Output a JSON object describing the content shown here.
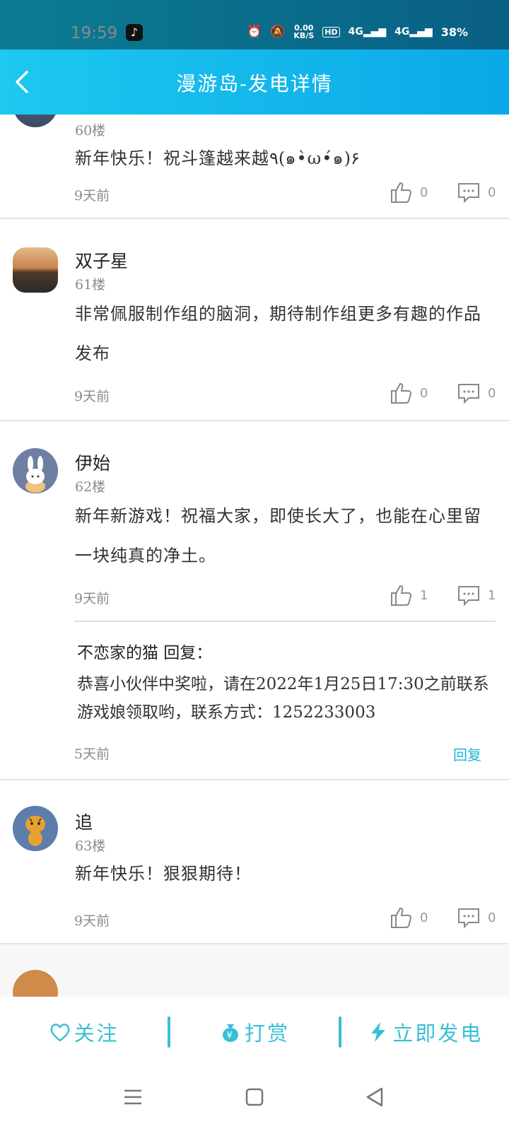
{
  "status_bar": {
    "time": "19:59",
    "net_speed_value": "0.00",
    "net_speed_unit": "KB/S",
    "hd": "HD",
    "signal1": "4G",
    "signal2": "4G",
    "battery": "38%"
  },
  "header": {
    "title": "漫游岛-发电详情"
  },
  "posts": [
    {
      "floor": "60楼",
      "content": "新年快乐！祝斗篷越来越٩(๑•̀ω•́๑)۶",
      "time": "9天前",
      "likes": "0",
      "comments": "0"
    },
    {
      "username": "双子星",
      "floor": "61楼",
      "content": "非常佩服制作组的脑洞，期待制作组更多有趣的作品发布",
      "time": "9天前",
      "likes": "0",
      "comments": "0"
    },
    {
      "username": "伊始",
      "floor": "62楼",
      "content": "新年新游戏！祝福大家，即使长大了，也能在心里留一块纯真的净土。",
      "time": "9天前",
      "likes": "1",
      "comments": "1",
      "reply": {
        "name": "不恋家的猫 回复：",
        "text": "恭喜小伙伴中奖啦，请在2022年1月25日17:30之前联系游戏娘领取哟，联系方式：1252233003",
        "time": "5天前",
        "reply_label": "回复"
      }
    },
    {
      "username": "追",
      "floor": "63楼",
      "content": "新年快乐！狠狠期待！",
      "time": "9天前",
      "likes": "0",
      "comments": "0"
    }
  ],
  "actions": {
    "follow": "关注",
    "reward": "打赏",
    "power": "立即发电"
  },
  "colors": {
    "accent": "#38bfd6",
    "header_bg": "#12b6eb",
    "statusbar_bg": "#0b6f8b"
  }
}
